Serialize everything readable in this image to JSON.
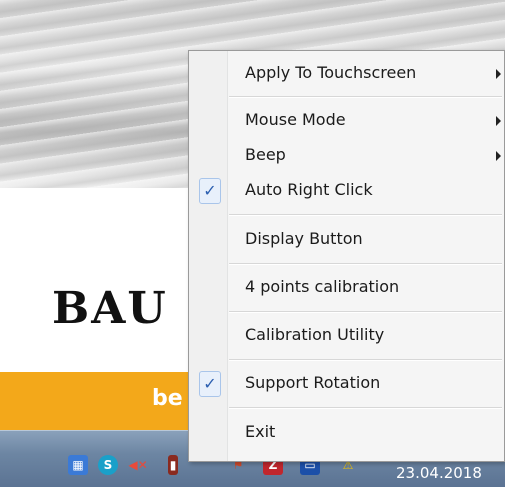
{
  "menu": {
    "items": [
      {
        "label": "Apply To Touchscreen",
        "checked": false,
        "submenu": true
      },
      {
        "label": "Mouse Mode",
        "checked": false,
        "submenu": true
      },
      {
        "label": "Beep",
        "checked": false,
        "submenu": true
      },
      {
        "label": "Auto Right Click",
        "checked": true,
        "submenu": false
      },
      {
        "label": "Display Button",
        "checked": false,
        "submenu": false
      },
      {
        "label": "4 points calibration",
        "checked": false,
        "submenu": false
      },
      {
        "label": "Calibration Utility",
        "checked": false,
        "submenu": false
      },
      {
        "label": "Support Rotation",
        "checked": true,
        "submenu": false
      },
      {
        "label": "Exit",
        "checked": false,
        "submenu": false
      }
    ],
    "check_glyph": "✓",
    "check_color": "#2c5fb0"
  },
  "background": {
    "brand_text": "BAU",
    "bar_text": "be",
    "bar_color": "#f3a81a"
  },
  "taskbar": {
    "date": "23.04.2018",
    "tray_icons": [
      "network-icon",
      "app-s-icon",
      "speaker-muted-icon",
      "usb-icon",
      "flag-icon",
      "filezilla-icon",
      "monitor-icon",
      "lock-warning-icon"
    ]
  }
}
